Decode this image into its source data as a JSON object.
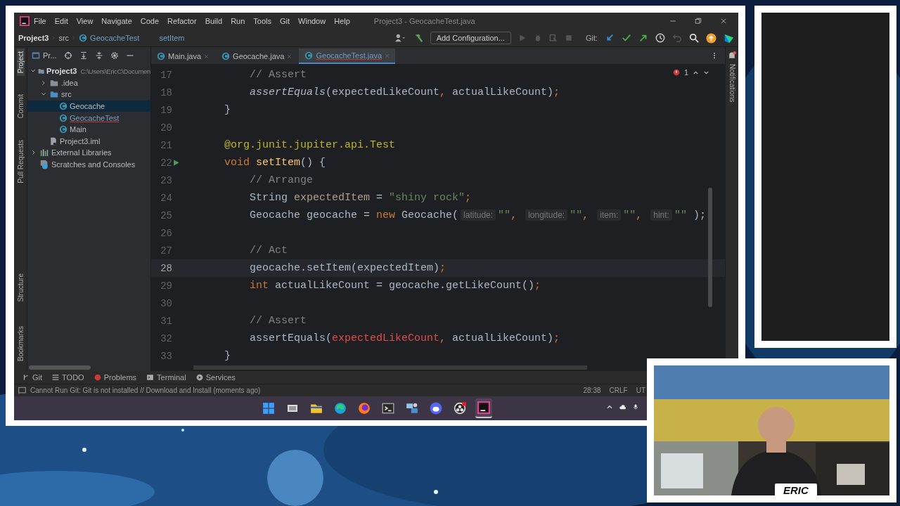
{
  "ide": {
    "title": "Project3 - GeocacheTest.java",
    "menu": [
      "File",
      "Edit",
      "View",
      "Navigate",
      "Code",
      "Refactor",
      "Build",
      "Run",
      "Tools",
      "Git",
      "Window",
      "Help"
    ],
    "breadcrumbs": [
      {
        "label": "Project3",
        "kind": "project"
      },
      {
        "label": "src",
        "kind": "folder"
      },
      {
        "label": "GeocacheTest",
        "kind": "class"
      },
      {
        "label": "setItem",
        "kind": "method"
      }
    ],
    "run_config": "Add Configuration...",
    "git_label": "Git:",
    "left_tools": [
      {
        "label": "Project",
        "selected": true
      },
      {
        "label": "Commit",
        "selected": false
      },
      {
        "label": "Pull Requests",
        "selected": false
      }
    ],
    "left_tools_bottom": [
      {
        "label": "Structure",
        "selected": false
      },
      {
        "label": "Bookmarks",
        "selected": false
      }
    ],
    "project_panel": {
      "title": "Pr...",
      "tree": [
        {
          "label": "Project3",
          "kind": "module",
          "path": "C:\\Users\\EricC\\Documen",
          "expanded": true,
          "selected": false,
          "has_error": false,
          "children": [
            {
              "label": ".idea",
              "kind": "folder",
              "expanded": false,
              "selected": false,
              "has_error": false
            },
            {
              "label": "src",
              "kind": "source",
              "expanded": true,
              "selected": false,
              "has_error": false,
              "children": [
                {
                  "label": "Geocache",
                  "kind": "class",
                  "selected": true,
                  "has_error": false
                },
                {
                  "label": "GeocacheTest",
                  "kind": "class",
                  "selected": false,
                  "has_error": true
                },
                {
                  "label": "Main",
                  "kind": "class",
                  "selected": false,
                  "has_error": false
                }
              ]
            },
            {
              "label": "Project3.iml",
              "kind": "file",
              "selected": false,
              "has_error": false
            }
          ]
        },
        {
          "label": "External Libraries",
          "kind": "library",
          "expanded": false,
          "selected": false,
          "has_error": false
        },
        {
          "label": "Scratches and Consoles",
          "kind": "scratch",
          "selected": false,
          "has_error": false
        }
      ]
    },
    "tabs": [
      {
        "label": "Main.java",
        "selected": false,
        "has_error": false
      },
      {
        "label": "Geocache.java",
        "selected": false,
        "has_error": false
      },
      {
        "label": "GeocacheTest.java",
        "selected": true,
        "has_error": true
      }
    ],
    "problems_count": "1",
    "notifications_label": "Notifications",
    "lines": [
      {
        "number": "17",
        "current": false,
        "tokens": [
          {
            "kind": "comment",
            "text": "        // Assert"
          }
        ]
      },
      {
        "number": "18",
        "current": false,
        "tokens": [
          {
            "kind": "static",
            "text": "        assertEquals"
          },
          {
            "kind": "plain",
            "text": "(expectedLikeCount"
          },
          {
            "kind": "punct",
            "text": ", "
          },
          {
            "kind": "plain",
            "text": "actualLikeCount)"
          },
          {
            "kind": "punct",
            "text": ";"
          }
        ]
      },
      {
        "number": "19",
        "current": false,
        "tokens": [
          {
            "kind": "plain",
            "text": "    }"
          }
        ]
      },
      {
        "number": "20",
        "current": false,
        "has_run_icon": false
      },
      {
        "number": "21",
        "current": false,
        "tokens": [
          {
            "kind": "annotation",
            "text": "    @org.junit.jupiter.api.Test"
          }
        ]
      },
      {
        "number": "22",
        "current": false,
        "has_run_icon": true,
        "tokens": [
          {
            "kind": "keyword",
            "text": "    void "
          },
          {
            "kind": "declaration",
            "text": "setItem"
          },
          {
            "kind": "plain",
            "text": "() {"
          }
        ]
      },
      {
        "number": "23",
        "current": false,
        "tokens": [
          {
            "kind": "comment",
            "text": "        // Arrange"
          }
        ]
      },
      {
        "number": "24",
        "current": false,
        "tokens": [
          {
            "kind": "plain",
            "text": "        String "
          },
          {
            "kind": "unused",
            "text": "expectedItem"
          },
          {
            "kind": "plain",
            "text": " = "
          },
          {
            "kind": "string",
            "text": "\"shiny rock\""
          },
          {
            "kind": "punct",
            "text": ";"
          }
        ]
      },
      {
        "number": "25",
        "current": false,
        "tokens": [
          {
            "kind": "plain",
            "text": "        Geocache geocache = "
          },
          {
            "kind": "keyword",
            "text": "new "
          },
          {
            "kind": "plain",
            "text": "Geocache("
          },
          {
            "kind": "hint",
            "text": "latitude:"
          },
          {
            "kind": "string",
            "text": "\"\""
          },
          {
            "kind": "punct",
            "text": ", "
          },
          {
            "kind": "hint",
            "text": "longitude:"
          },
          {
            "kind": "string",
            "text": "\"\""
          },
          {
            "kind": "punct",
            "text": ", "
          },
          {
            "kind": "hint",
            "text": "item:"
          },
          {
            "kind": "string",
            "text": "\"\""
          },
          {
            "kind": "punct",
            "text": ", "
          },
          {
            "kind": "hint",
            "text": "hint:"
          },
          {
            "kind": "string",
            "text": "\"\" "
          },
          {
            "kind": "plain",
            "text": ");"
          }
        ]
      },
      {
        "number": "26",
        "current": false,
        "has_run_icon": false
      },
      {
        "number": "27",
        "current": false,
        "tokens": [
          {
            "kind": "comment",
            "text": "        // Act"
          }
        ]
      },
      {
        "number": "28",
        "current": true,
        "tokens": [
          {
            "kind": "plain",
            "text": "        geocache.setItem(expectedItem)"
          },
          {
            "kind": "punct",
            "text": ";"
          }
        ]
      },
      {
        "number": "29",
        "current": false,
        "tokens": [
          {
            "kind": "keyword",
            "text": "        int "
          },
          {
            "kind": "plain",
            "text": "actualLikeCount = geocache.getLikeCount()"
          },
          {
            "kind": "punct",
            "text": ";"
          }
        ]
      },
      {
        "number": "30",
        "current": false,
        "has_run_icon": false
      },
      {
        "number": "31",
        "current": false,
        "tokens": [
          {
            "kind": "comment",
            "text": "        // Assert"
          }
        ]
      },
      {
        "number": "32",
        "current": false,
        "tokens": [
          {
            "kind": "plain",
            "text": "        assertEquals("
          },
          {
            "kind": "error",
            "text": "expectedLikeCount"
          },
          {
            "kind": "punct",
            "text": ", "
          },
          {
            "kind": "plain",
            "text": "actualLikeCount)"
          },
          {
            "kind": "punct",
            "text": ";"
          }
        ]
      },
      {
        "number": "33",
        "current": false,
        "tokens": [
          {
            "kind": "plain",
            "text": "    }"
          }
        ]
      }
    ],
    "tool_windows": [
      {
        "label": "Git",
        "kind": "git"
      },
      {
        "label": "TODO",
        "kind": "todo"
      },
      {
        "label": "Problems",
        "kind": "problems"
      },
      {
        "label": "Terminal",
        "kind": "terminal"
      },
      {
        "label": "Services",
        "kind": "services"
      }
    ],
    "status_message": "Cannot Run Git: Git is not installed // Download and Install (moments ago)",
    "status_items": [
      "28:38",
      "CRLF",
      "UT"
    ]
  },
  "taskbar": {
    "apps": [
      {
        "kind": "windows",
        "active": false
      },
      {
        "kind": "taskview",
        "active": false
      },
      {
        "kind": "folder",
        "active": false
      },
      {
        "kind": "edge",
        "active": false
      },
      {
        "kind": "firefox",
        "active": false
      },
      {
        "kind": "terminal",
        "active": false
      },
      {
        "kind": "network",
        "active": false
      },
      {
        "kind": "chat",
        "active": false
      },
      {
        "kind": "record",
        "active": false
      },
      {
        "kind": "ide",
        "active": true
      }
    ],
    "tray": [
      {
        "kind": "chevron"
      },
      {
        "kind": "cloud"
      },
      {
        "kind": "mic"
      }
    ]
  },
  "webcam": {
    "kind": "picture",
    "name_tag": "ERIC"
  }
}
